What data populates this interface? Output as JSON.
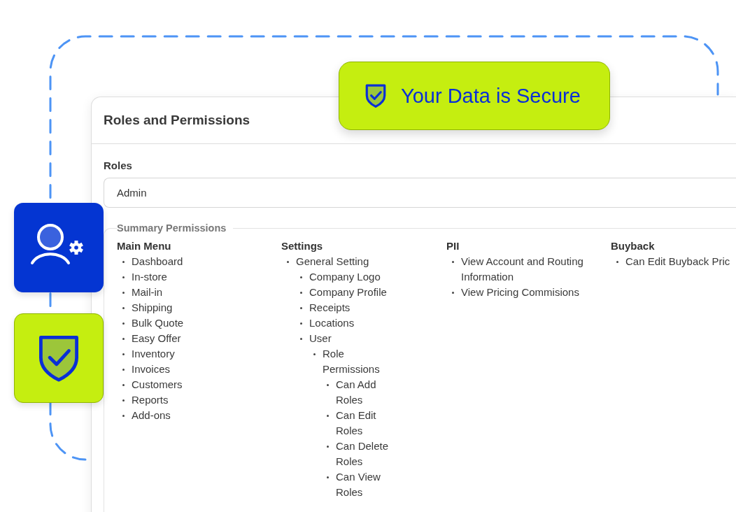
{
  "badge": {
    "text": "Your Data is Secure"
  },
  "panel": {
    "title": "Roles and Permissions",
    "roles_field": {
      "label": "Roles",
      "value": "Admin"
    },
    "summary": {
      "legend": "Summary Permissions",
      "groups": [
        {
          "heading": "Main Menu",
          "items": [
            {
              "label": "Dashboard"
            },
            {
              "label": "In-store"
            },
            {
              "label": "Mail-in"
            },
            {
              "label": "Shipping"
            },
            {
              "label": "Bulk Quote"
            },
            {
              "label": "Easy Offer"
            },
            {
              "label": "Inventory"
            },
            {
              "label": "Invoices"
            },
            {
              "label": "Customers"
            },
            {
              "label": "Reports"
            },
            {
              "label": "Add-ons"
            }
          ]
        },
        {
          "heading": "Settings",
          "items": [
            {
              "label": "General Setting",
              "children": [
                {
                  "label": "Company Logo"
                },
                {
                  "label": "Company Profile"
                },
                {
                  "label": "Receipts"
                },
                {
                  "label": "Locations"
                },
                {
                  "label": "User",
                  "children": [
                    {
                      "label": "Role Permissions",
                      "children": [
                        {
                          "label": "Can Add Roles"
                        },
                        {
                          "label": "Can Edit Roles"
                        },
                        {
                          "label": "Can Delete Roles"
                        },
                        {
                          "label": "Can View Roles"
                        }
                      ]
                    }
                  ]
                }
              ]
            }
          ]
        },
        {
          "heading": "PII",
          "items": [
            {
              "label": "View Account and Routing Information"
            },
            {
              "label": "View Pricing Commisions"
            }
          ]
        },
        {
          "heading": "Buyback",
          "items": [
            {
              "label": "Can Edit Buyback Pric"
            }
          ]
        }
      ]
    }
  }
}
